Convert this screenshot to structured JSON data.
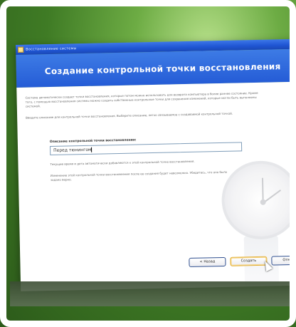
{
  "window": {
    "title": "Восстановление системы",
    "header_title": "Создание контрольной точки восстановления"
  },
  "body": {
    "intro_paragraph": "Система автоматически создает точки восстановления, которые потом можно использовать для возврата компьютера в более раннее состояние. Кроме того, с помощью восстановления системы можно создать собственные контрольные точки для сохранения изменений, которые могли быть выполнены системой.",
    "description_paragraph": "Введите описание для контрольной точки восстановления. Выберите описание, легко связываемое с создаваемой контрольной точкой.",
    "field_label": "Описание контрольной точки восстановления:",
    "field_value": "Перед тюнингом",
    "note_datetime": "Текущие время и дата автоматически добавляются к этой контрольной точке восстановления.",
    "note_after": "Изменение этой контрольной точки восстановления после ее создания будет невозможно. Убедитесь, что оно было задано верно."
  },
  "buttons": {
    "back": "< Назад",
    "next": "Создать",
    "cancel": "Отмена"
  },
  "colors": {
    "title_blue": "#255cd6",
    "desktop_green": "#4f8d2e",
    "default_button_border": "#e3b13a"
  },
  "icons": {
    "clock": "clock-watermark-icon",
    "window": "window-app-icon",
    "cursor": "mouse-pointer-icon"
  }
}
